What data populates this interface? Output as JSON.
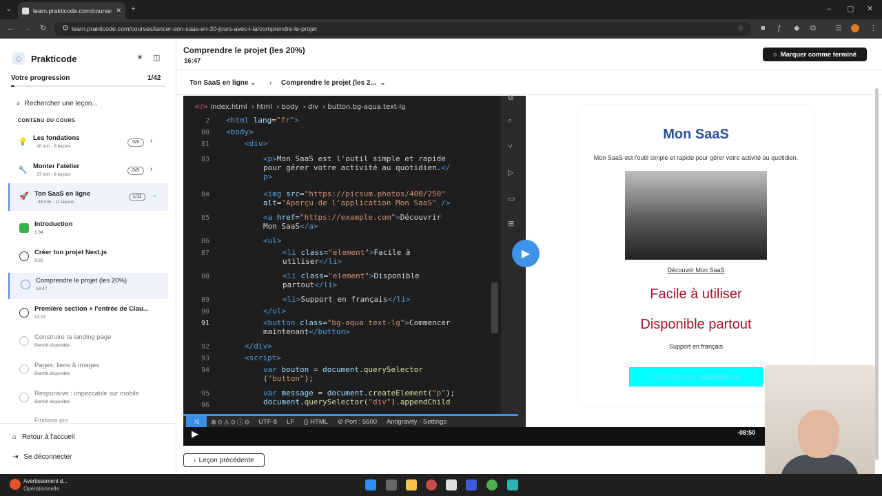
{
  "browser": {
    "tab_title": "learn.prakticode.com/courses/la",
    "url": "learn.prakticode.com/courses/lancer-son-saas-en-30-jours-avec-l-ia/comprendre-le-projet"
  },
  "sidebar": {
    "brand": "Prakticode",
    "progress_label": "Votre progression",
    "progress_value": "1/42",
    "progress_fraction": 0.024,
    "search_placeholder": "Rechercher une leçon...",
    "section_title": "CONTENU DU COURS",
    "modules": [
      {
        "title": "Les fondations",
        "sub": "20 min · 8 leçons",
        "badge": "0/8",
        "icon": "lightbulb-icon"
      },
      {
        "title": "Monter l'atelier",
        "sub": "37 min · 8 leçons",
        "badge": "0/8",
        "icon": "wrench-icon"
      },
      {
        "title": "Ton SaaS en ligne",
        "sub": "39 min · 11 leçons",
        "badge": "1/11",
        "icon": "rocket-icon"
      }
    ],
    "lessons": [
      {
        "title": "Introduction",
        "sub": "1:34"
      },
      {
        "title": "Créer ton projet Next.js",
        "sub": "8:32"
      },
      {
        "title": "Comprendre le projet (les 20%)",
        "sub": "16:47"
      },
      {
        "title": "Première section + l'entrée de Clau...",
        "sub": "12:07"
      },
      {
        "title": "Construire ta landing page",
        "sub": "Bientôt disponible"
      },
      {
        "title": "Pages, liens & images",
        "sub": "Bientôt disponible"
      },
      {
        "title": "Responsive : impeccable sur mobile",
        "sub": "Bientôt disponible"
      },
      {
        "title": "Finitions pro",
        "sub": ""
      }
    ],
    "home_label": "Retour à l'accueil",
    "logout_label": "Se déconnecter"
  },
  "header": {
    "title": "Comprendre le projet (les 20%)",
    "duration": "16:47",
    "complete_label": "Marquer comme terminé"
  },
  "crumbs": {
    "module": "Ton SaaS en ligne",
    "lesson": "Comprendre le projet (les 2..."
  },
  "editor": {
    "breadcrumb": [
      "index.html",
      "html",
      "body",
      "div",
      "button.bg-aqua.text-lg"
    ],
    "line_numbers": [
      "2",
      "80",
      "81",
      "83",
      "84",
      "85",
      "86",
      "87",
      "88",
      "89",
      "90",
      "91",
      "92",
      "93",
      "94",
      "95",
      "96"
    ],
    "status": {
      "errors": "0",
      "warnings": "0",
      "info": "0",
      "encoding": "UTF-8",
      "eol": "LF",
      "lang": "HTML",
      "port": "Port : 5500",
      "app": "Antigravity - Settings"
    }
  },
  "preview": {
    "title": "Mon SaaS",
    "text": "Mon SaaS est l'outil simple et rapide pour gérer votre activité au quotidien.",
    "link": "Découvrir Mon SaaS",
    "li1": "Facile à utiliser",
    "li2": "Disponible partout",
    "li3": "Support en français",
    "button": "Commencer maintenant"
  },
  "video": {
    "remaining": "-08:50"
  },
  "footer": {
    "prev_label": "Leçon précédente"
  },
  "taskbar": {
    "warn_title": "Avertissement d...",
    "warn_sub": "Opérationnelle"
  },
  "colors": {
    "accent": "#5b8ad6",
    "preview_title": "#2a4f98",
    "preview_red": "#a4122a",
    "aqua": "#00ffff"
  }
}
